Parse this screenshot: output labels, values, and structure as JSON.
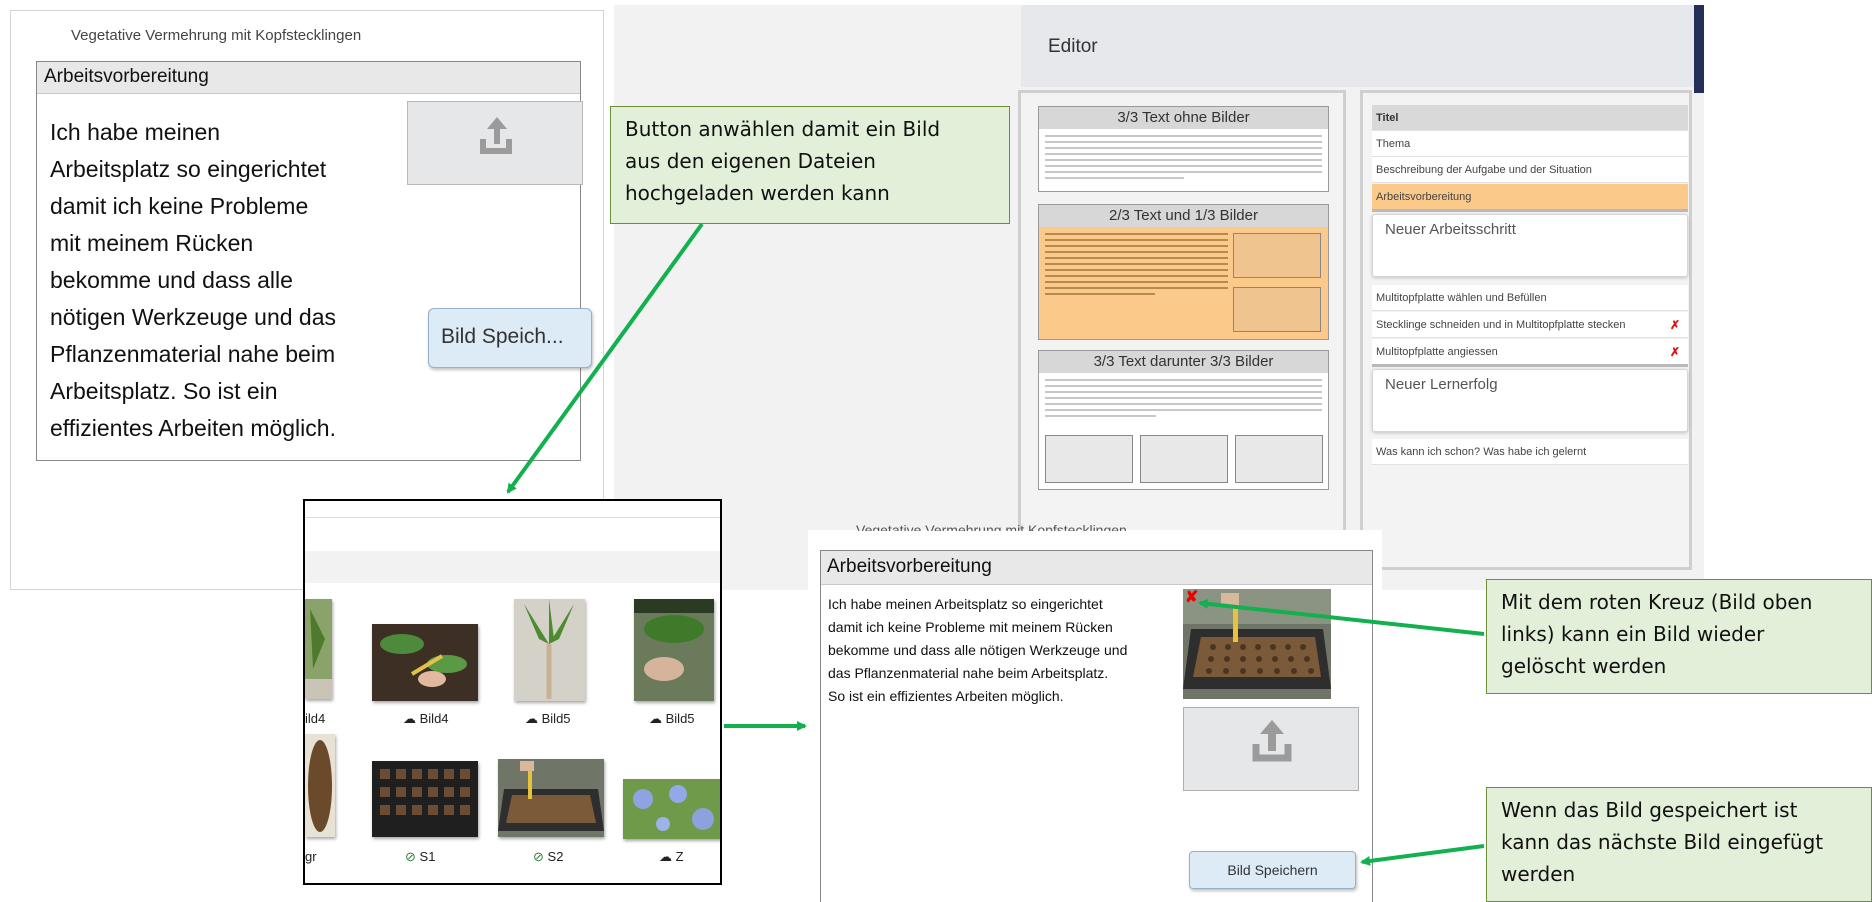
{
  "panel1": {
    "title": "Vegetative Vermehrung mit Kopfstecklingen",
    "section": "Arbeitsvorbereitung",
    "text": "Ich habe meinen\nArbeitsplatz so eingerichtet\ndamit ich keine Probleme\nmit meinem Rücken\nbekomme und dass alle\nnötigen Werkzeuge und das\nPflanzenmaterial  nahe beim\nArbeitsplatz. So ist ein\neffizientes Arbeiten möglich.",
    "upload_icon": "upload-icon",
    "save_label": "Bild Speich..."
  },
  "editor": {
    "title": "Editor",
    "templates": [
      {
        "title": "3/3 Text ohne Bilder"
      },
      {
        "title": "2/3 Text und 1/3 Bilder"
      },
      {
        "title": "3/3 Text darunter 3/3 Bilder"
      }
    ],
    "outline": {
      "titel": "Titel",
      "thema": "Thema",
      "beschreibung": "Beschreibung der Aufgabe und der Situation",
      "arbeitsvorbereitung": "Arbeitsvorbereitung",
      "neuer_arbeitsschritt": "Neuer Arbeitsschritt",
      "step1": "Multitopfplatte wählen und Befüllen",
      "step2": "Stecklinge schneiden und in Multitopfplatte stecken",
      "step3": "Multitopfplatte angiessen",
      "neuer_lernerfolg": "Neuer Lernerfolg",
      "reflexion": "Was kann ich schon? Was habe ich gelernt",
      "delete_mark": "✗"
    },
    "accent_color": "#fbca8a"
  },
  "picker": {
    "captions": [
      "ild4",
      "Bild4",
      "Bild5",
      "Bild5",
      "gr",
      "S1",
      "S2",
      "Z"
    ]
  },
  "panel3": {
    "overtext": "Vegetative Vermehrung mit Kopfstecklingen",
    "section": "Arbeitsvorbereitung",
    "text": "Ich habe meinen Arbeitsplatz so eingerichtet\ndamit ich keine Probleme mit meinem Rücken\nbekomme und dass alle nötigen Werkzeuge und\ndas Pflanzenmaterial  nahe beim Arbeitsplatz.\nSo ist ein effizientes Arbeiten möglich.",
    "delete_mark": "✘",
    "save_label": "Bild Speichern"
  },
  "callouts": {
    "upload": "Button anwählen damit ein Bild\naus den eigenen Dateien\nhochgeladen werden kann",
    "delete": "Mit dem roten Kreuz (Bild oben\nlinks) kann ein Bild wieder\ngelöscht werden",
    "next": "Wenn das Bild gespeichert ist\nkann das nächste Bild eingefügt\nwerden"
  },
  "colors": {
    "callout_bg": "#e2f0d9",
    "arrow": "#12b04f",
    "button_bg": "#ddebf7",
    "delete_red": "#e00000"
  }
}
